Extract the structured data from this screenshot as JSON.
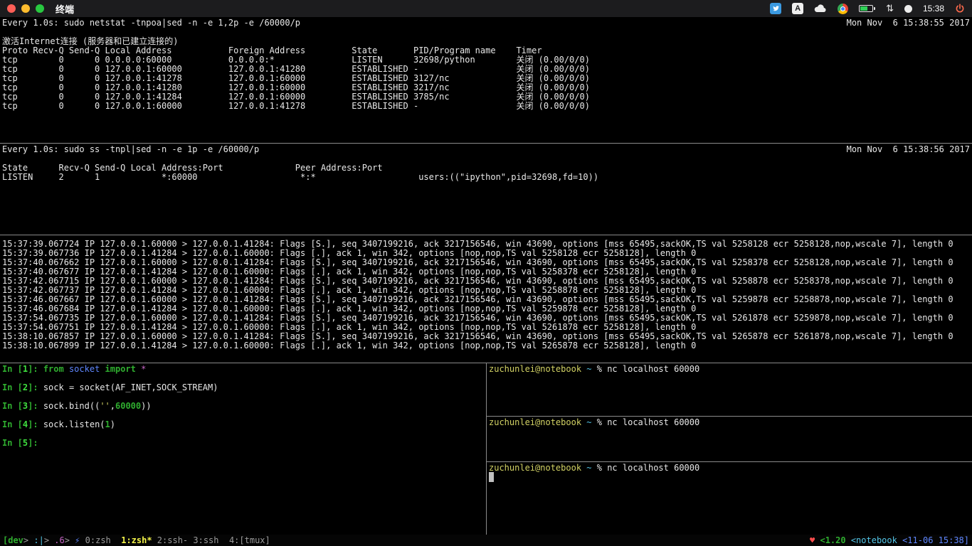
{
  "palette": {
    "w": "#e8e8e8",
    "gy": "#9c9c9c",
    "g": "#2fae2f",
    "gb": "#3fe03f",
    "y": "#d2d264",
    "yb": "#f5f549",
    "c": "#53c6e8",
    "b": "#5f87ff",
    "m": "#c766c7",
    "r": "#ff4d4d",
    "cur": "#c0c0c0"
  },
  "bold_keys": [
    "g",
    "gb",
    "yb"
  ],
  "menubar": {
    "app_title": "终端",
    "clock": "15:38",
    "icons": [
      "twitter",
      "input-source",
      "cloud",
      "chrome",
      "battery",
      "sync-arrows",
      "notification",
      "power"
    ],
    "input_source_label": "A",
    "sync_arrows_glyph": "⇅"
  },
  "watch_netstat": {
    "command": "Every 1.0s: sudo netstat -tnpoa|sed -n -e 1,2p -e /60000/p",
    "date": "Mon Nov  6 15:38:55 2017",
    "lines": [
      "激活Internet连接 (服务器和已建立连接的)",
      "Proto Recv-Q Send-Q Local Address           Foreign Address         State       PID/Program name    Timer",
      "tcp        0      0 0.0.0.0:60000           0.0.0.0:*               LISTEN      32698/python        关闭 (0.00/0/0)",
      "tcp        0      0 127.0.0.1:60000         127.0.0.1:41280         ESTABLISHED -                   关闭 (0.00/0/0)",
      "tcp        0      0 127.0.0.1:41278         127.0.0.1:60000         ESTABLISHED 3127/nc             关闭 (0.00/0/0)",
      "tcp        0      0 127.0.0.1:41280         127.0.0.1:60000         ESTABLISHED 3217/nc             关闭 (0.00/0/0)",
      "tcp        0      0 127.0.0.1:41284         127.0.0.1:60000         ESTABLISHED 3785/nc             关闭 (0.00/0/0)",
      "tcp        0      0 127.0.0.1:60000         127.0.0.1:41278         ESTABLISHED -                   关闭 (0.00/0/0)"
    ]
  },
  "watch_ss": {
    "command": "Every 1.0s: sudo ss -tnpl|sed -n -e 1p -e /60000/p",
    "date": "Mon Nov  6 15:38:56 2017",
    "lines": [
      "State      Recv-Q Send-Q Local Address:Port              Peer Address:Port",
      "LISTEN     2      1            *:60000                    *:*                    users:((\"ipython\",pid=32698,fd=10))"
    ]
  },
  "tcpdump": {
    "lines": [
      "15:37:39.067724 IP 127.0.0.1.60000 > 127.0.0.1.41284: Flags [S.], seq 3407199216, ack 3217156546, win 43690, options [mss 65495,sackOK,TS val 5258128 ecr 5258128,nop,wscale 7], length 0",
      "15:37:39.067736 IP 127.0.0.1.41284 > 127.0.0.1.60000: Flags [.], ack 1, win 342, options [nop,nop,TS val 5258128 ecr 5258128], length 0",
      "15:37:40.067662 IP 127.0.0.1.60000 > 127.0.0.1.41284: Flags [S.], seq 3407199216, ack 3217156546, win 43690, options [mss 65495,sackOK,TS val 5258378 ecr 5258128,nop,wscale 7], length 0",
      "15:37:40.067677 IP 127.0.0.1.41284 > 127.0.0.1.60000: Flags [.], ack 1, win 342, options [nop,nop,TS val 5258378 ecr 5258128], length 0",
      "15:37:42.067715 IP 127.0.0.1.60000 > 127.0.0.1.41284: Flags [S.], seq 3407199216, ack 3217156546, win 43690, options [mss 65495,sackOK,TS val 5258878 ecr 5258378,nop,wscale 7], length 0",
      "15:37:42.067737 IP 127.0.0.1.41284 > 127.0.0.1.60000: Flags [.], ack 1, win 342, options [nop,nop,TS val 5258878 ecr 5258128], length 0",
      "15:37:46.067667 IP 127.0.0.1.60000 > 127.0.0.1.41284: Flags [S.], seq 3407199216, ack 3217156546, win 43690, options [mss 65495,sackOK,TS val 5259878 ecr 5258878,nop,wscale 7], length 0",
      "15:37:46.067684 IP 127.0.0.1.41284 > 127.0.0.1.60000: Flags [.], ack 1, win 342, options [nop,nop,TS val 5259878 ecr 5258128], length 0",
      "15:37:54.067735 IP 127.0.0.1.60000 > 127.0.0.1.41284: Flags [S.], seq 3407199216, ack 3217156546, win 43690, options [mss 65495,sackOK,TS val 5261878 ecr 5259878,nop,wscale 7], length 0",
      "15:37:54.067751 IP 127.0.0.1.41284 > 127.0.0.1.60000: Flags [.], ack 1, win 342, options [nop,nop,TS val 5261878 ecr 5258128], length 0",
      "15:38:10.067857 IP 127.0.0.1.60000 > 127.0.0.1.41284: Flags [S.], seq 3407199216, ack 3217156546, win 43690, options [mss 65495,sackOK,TS val 5265878 ecr 5261878,nop,wscale 7], length 0",
      "15:38:10.067899 IP 127.0.0.1.41284 > 127.0.0.1.60000: Flags [.], ack 1, win 342, options [nop,nop,TS val 5265878 ecr 5258128], length 0"
    ]
  },
  "ipython": {
    "lines": [
      [
        [
          "g",
          "In ["
        ],
        [
          "gb",
          "1"
        ],
        [
          "g",
          "]: "
        ],
        [
          "g",
          "from "
        ],
        [
          "b",
          "socket "
        ],
        [
          "g",
          "import "
        ],
        [
          "m",
          "*"
        ]
      ],
      [],
      [
        [
          "g",
          "In ["
        ],
        [
          "gb",
          "2"
        ],
        [
          "g",
          "]: "
        ],
        [
          "w",
          "sock = socket(AF_INET,SOCK_STREAM)"
        ]
      ],
      [],
      [
        [
          "g",
          "In ["
        ],
        [
          "gb",
          "3"
        ],
        [
          "g",
          "]: "
        ],
        [
          "w",
          "sock.bind(("
        ],
        [
          "y",
          "''"
        ],
        [
          "w",
          ","
        ],
        [
          "g",
          "60000"
        ],
        [
          "w",
          "))"
        ]
      ],
      [],
      [
        [
          "g",
          "In ["
        ],
        [
          "gb",
          "4"
        ],
        [
          "g",
          "]: "
        ],
        [
          "w",
          "sock.listen("
        ],
        [
          "g",
          "1"
        ],
        [
          "w",
          ")"
        ]
      ],
      [],
      [
        [
          "g",
          "In ["
        ],
        [
          "gb",
          "5"
        ],
        [
          "g",
          "]: "
        ]
      ]
    ]
  },
  "nc1": {
    "lines": [
      [
        [
          "y",
          "zuchunlei@notebook"
        ],
        [
          "w",
          " "
        ],
        [
          "c",
          "~"
        ],
        [
          "w",
          " % nc localhost 60000"
        ]
      ]
    ]
  },
  "nc2": {
    "lines": [
      [
        [
          "y",
          "zuchunlei@notebook"
        ],
        [
          "w",
          " "
        ],
        [
          "c",
          "~"
        ],
        [
          "w",
          " % nc localhost 60000"
        ]
      ]
    ]
  },
  "nc3": {
    "lines": [
      [
        [
          "y",
          "zuchunlei@notebook"
        ],
        [
          "w",
          " "
        ],
        [
          "c",
          "~"
        ],
        [
          "w",
          " % nc localhost 60000"
        ]
      ],
      [
        [
          "cur",
          " "
        ]
      ]
    ]
  },
  "statusbar": {
    "left": [
      [
        "g",
        "[dev"
      ],
      [
        "gy",
        "> "
      ],
      [
        "c",
        ":|"
      ],
      [
        "gy",
        "> "
      ],
      [
        "m",
        ".6"
      ],
      [
        "gy",
        "> "
      ],
      [
        "b",
        "⚡"
      ],
      [
        "w",
        " "
      ],
      [
        "gy",
        "0:zsh  "
      ],
      [
        "yb",
        "1:zsh* "
      ],
      [
        "gy",
        "2:ssh- 3:ssh  4:[tmux]"
      ]
    ],
    "right": [
      [
        "r",
        "♥ "
      ],
      [
        "g",
        "<1.20 "
      ],
      [
        "c",
        "<notebook "
      ],
      [
        "b",
        "<11-06 15:38]"
      ]
    ]
  }
}
